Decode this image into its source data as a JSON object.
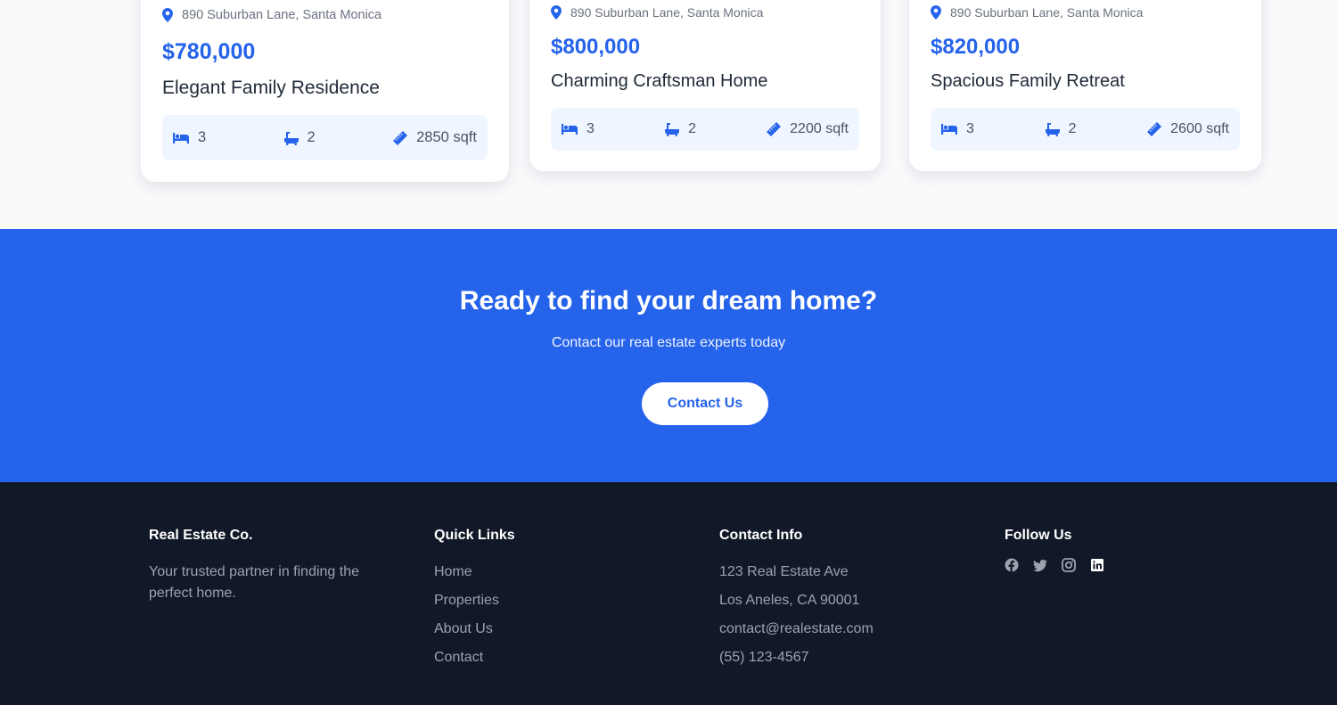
{
  "colors": {
    "accent": "#2563eb",
    "footer_bg": "#111827",
    "page_bg": "#f8fafc",
    "stats_bg": "#eff6ff"
  },
  "listings": [
    {
      "address": "890 Suburban Lane, Santa Monica",
      "price": "$780,000",
      "title": "Elegant Family Residence",
      "beds": "3",
      "baths": "2",
      "area": "2850 sqft"
    },
    {
      "address": "890 Suburban Lane, Santa Monica",
      "price": "$800,000",
      "title": "Charming Craftsman Home",
      "beds": "3",
      "baths": "2",
      "area": "2200 sqft"
    },
    {
      "address": "890 Suburban Lane, Santa Monica",
      "price": "$820,000",
      "title": "Spacious Family Retreat",
      "beds": "3",
      "baths": "2",
      "area": "2600 sqft"
    }
  ],
  "icons": {
    "address": "map-pin-icon",
    "beds": "bed-icon",
    "baths": "bath-icon",
    "area": "ruler-icon"
  },
  "cta": {
    "title": "Ready to find your dream home?",
    "subtitle": "Contact our real estate experts today",
    "button": "Contact Us"
  },
  "footer": {
    "brand": {
      "title": "Real Estate Co.",
      "tagline": "Your trusted partner in finding the perfect home."
    },
    "quick_links": {
      "title": "Quick Links",
      "items": [
        "Home",
        "Properties",
        "About Us",
        "Contact"
      ]
    },
    "contact": {
      "title": "Contact Info",
      "items": [
        "123 Real Estate Ave",
        "Los Aneles, CA 90001",
        "contact@realestate.com",
        "(55) 123-4567"
      ]
    },
    "follow": {
      "title": "Follow Us",
      "icons": [
        "facebook-icon",
        "twitter-icon",
        "instagram-icon",
        "linkedin-icon"
      ]
    }
  }
}
